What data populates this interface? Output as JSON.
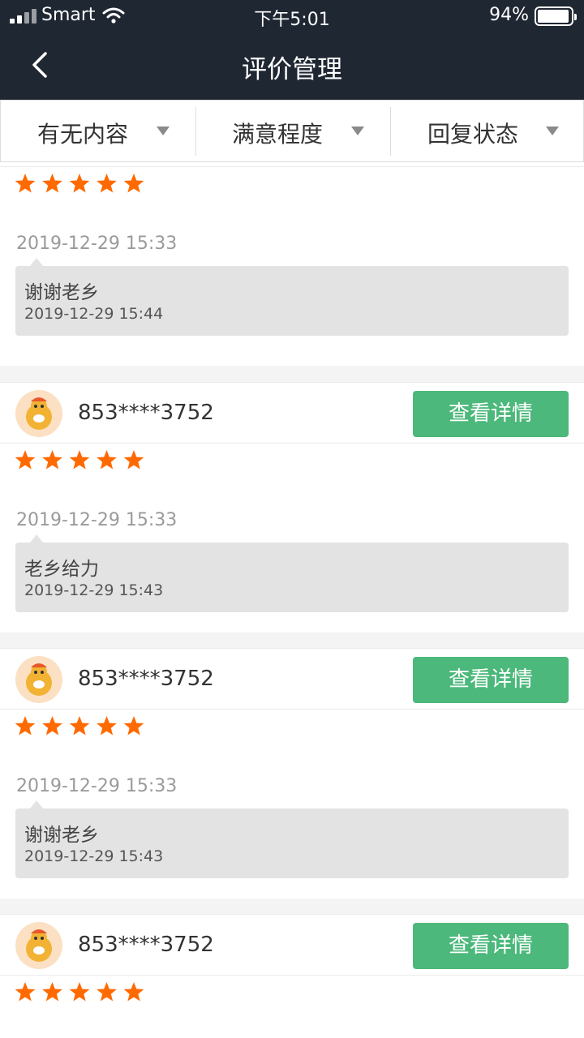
{
  "status": {
    "carrier": "Smart",
    "time": "下午5:01",
    "battery": "94%"
  },
  "header": {
    "title": "评价管理"
  },
  "filters": [
    {
      "label": "有无内容"
    },
    {
      "label": "满意程度"
    },
    {
      "label": "回复状态"
    }
  ],
  "reviews": [
    {
      "user": "",
      "button": "",
      "rating": 5,
      "time": "2019-12-29 15:33",
      "reply": "谢谢老乡",
      "reply_time": "2019-12-29 15:44"
    },
    {
      "user": "853****3752",
      "button": "查看详情",
      "rating": 5,
      "time": "2019-12-29 15:33",
      "reply": "老乡给力",
      "reply_time": "2019-12-29 15:43"
    },
    {
      "user": "853****3752",
      "button": "查看详情",
      "rating": 5,
      "time": "2019-12-29 15:33",
      "reply": "谢谢老乡",
      "reply_time": "2019-12-29 15:43"
    },
    {
      "user": "853****3752",
      "button": "查看详情",
      "rating": 5
    }
  ],
  "colors": {
    "header_bg": "#1f2733",
    "accent_green": "#4cb87b",
    "star": "#ff6a00",
    "reply_bg": "#e3e3e3"
  }
}
